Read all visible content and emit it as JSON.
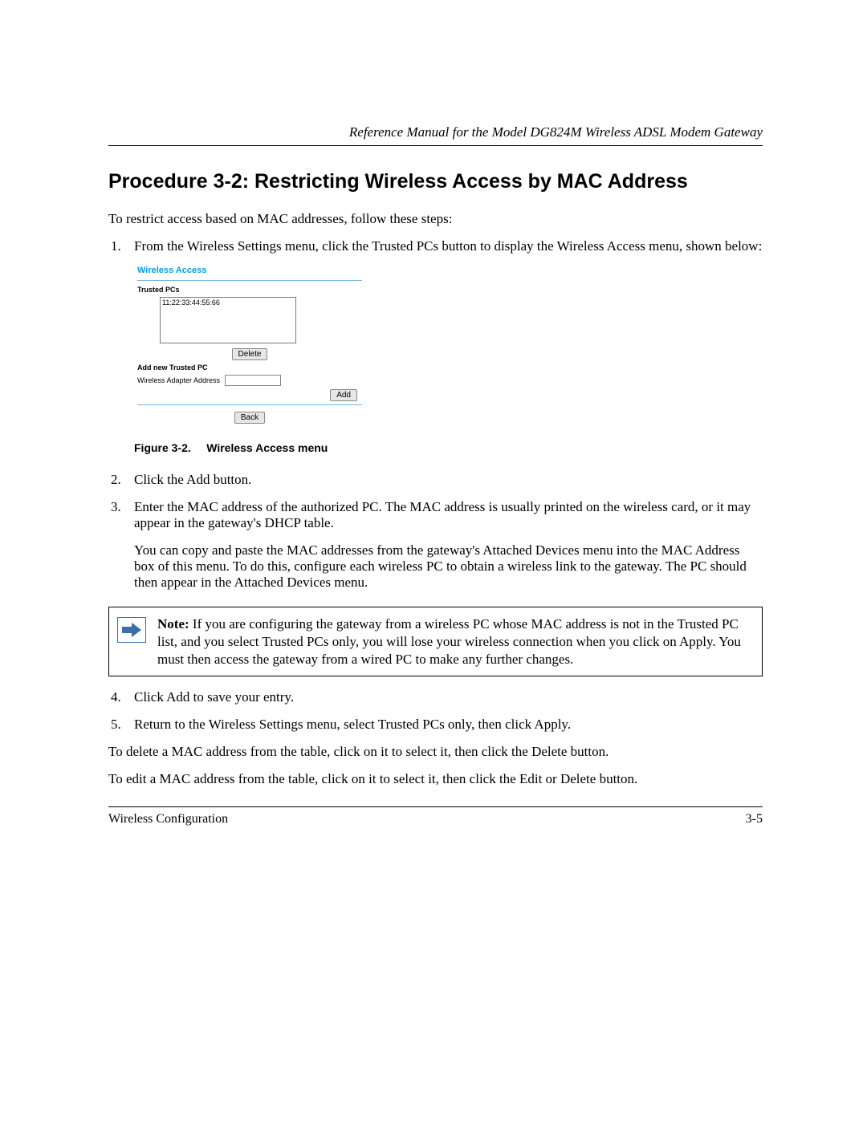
{
  "header": {
    "text": "Reference Manual for the Model DG824M Wireless ADSL Modem Gateway"
  },
  "title": "Procedure 3-2:  Restricting Wireless Access by MAC Address",
  "intro": "To restrict access based on MAC addresses, follow these steps:",
  "steps": {
    "s1": "From the Wireless Settings menu, click the Trusted PCs button to display the Wireless Access menu, shown below:",
    "s2": "Click the Add button.",
    "s3": "Enter the MAC address of the authorized PC. The MAC address is usually printed on the wireless card, or it may appear in the gateway's DHCP table.",
    "s3_extra": "You can copy and paste the MAC addresses from the gateway's Attached Devices menu into the MAC Address box of this menu. To do this, configure each wireless PC to obtain a wireless link to the gateway. The PC should then appear in the Attached Devices menu.",
    "s4": "Click Add to save your entry.",
    "s5": "Return to the Wireless Settings menu, select Trusted PCs only, then click Apply."
  },
  "ui": {
    "window_title": "Wireless Access",
    "trusted_label": "Trusted PCs",
    "mac_entry": "11:22:33:44:55:66",
    "delete_btn": "Delete",
    "add_new_label": "Add new Trusted PC",
    "adapter_label": "Wireless Adapter Address",
    "adapter_value": "",
    "add_btn": "Add",
    "back_btn": "Back"
  },
  "figure": {
    "label": "Figure 3-2.",
    "caption": "Wireless Access menu"
  },
  "note": {
    "lead": "Note: ",
    "body": "If you are configuring the gateway from a wireless PC whose MAC address is not in the Trusted PC list, and you select Trusted PCs only, you will lose your wireless connection when you click on Apply. You must then access the gateway from a wired PC to make any further changes."
  },
  "post": {
    "p1": "To delete a MAC address from the table, click on it to select it, then click the Delete button.",
    "p2": "To edit a MAC address from the table, click on it to select it, then click the Edit or Delete button."
  },
  "footer": {
    "left": "Wireless Configuration",
    "right": "3-5"
  }
}
